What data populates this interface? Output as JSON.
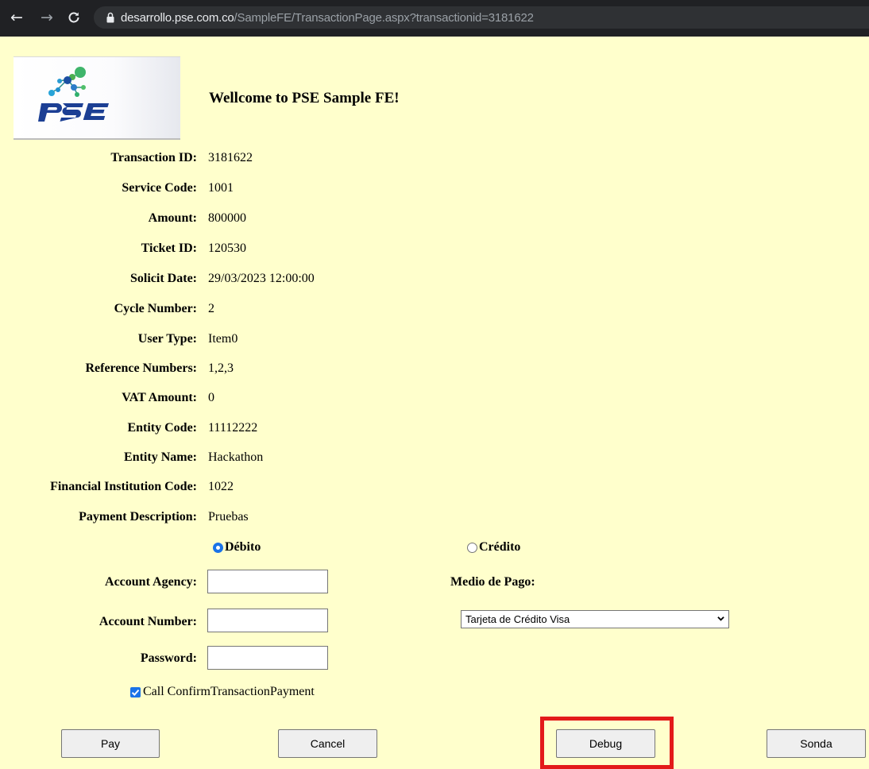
{
  "browser": {
    "url_host": "desarrollo.pse.com.co",
    "url_path": "/SampleFE/TransactionPage.aspx?transactionid=3181622"
  },
  "page": {
    "welcome": "Wellcome to PSE Sample FE!"
  },
  "fields": [
    {
      "label": "Transaction ID:",
      "value": "3181622"
    },
    {
      "label": "Service Code:",
      "value": "1001"
    },
    {
      "label": "Amount:",
      "value": "800000"
    },
    {
      "label": "Ticket ID:",
      "value": "120530"
    },
    {
      "label": "Solicit Date:",
      "value": "29/03/2023 12:00:00"
    },
    {
      "label": "Cycle Number:",
      "value": "2"
    },
    {
      "label": "User Type:",
      "value": "Item0"
    },
    {
      "label": "Reference Numbers:",
      "value": "1,2,3"
    },
    {
      "label": "VAT Amount:",
      "value": "0"
    },
    {
      "label": "Entity Code:",
      "value": "11112222"
    },
    {
      "label": "Entity Name:",
      "value": "Hackathon"
    },
    {
      "label": "Financial Institution Code:",
      "value": "1022"
    },
    {
      "label": "Payment Description:",
      "value": "Pruebas"
    }
  ],
  "payment_type": {
    "debit_label": "Débito",
    "credit_label": "Crédito",
    "selected": "Débito"
  },
  "form": {
    "account_agency_label": "Account Agency:",
    "account_agency_value": "",
    "account_number_label": "Account Number:",
    "account_number_value": "",
    "password_label": "Password:",
    "password_value": "",
    "medio_pago_label": "Medio de Pago:",
    "medio_pago_selected": "Tarjeta de Crédito Visa",
    "confirm_checkbox_label": "Call ConfirmTransactionPayment",
    "confirm_checked": true
  },
  "buttons": {
    "pay": "Pay",
    "cancel": "Cancel",
    "debug": "Debug",
    "sonda": "Sonda"
  },
  "colors": {
    "page_background": "#ffffcc",
    "highlight_border": "#e31a1a",
    "control_accent": "#1a73e8"
  }
}
